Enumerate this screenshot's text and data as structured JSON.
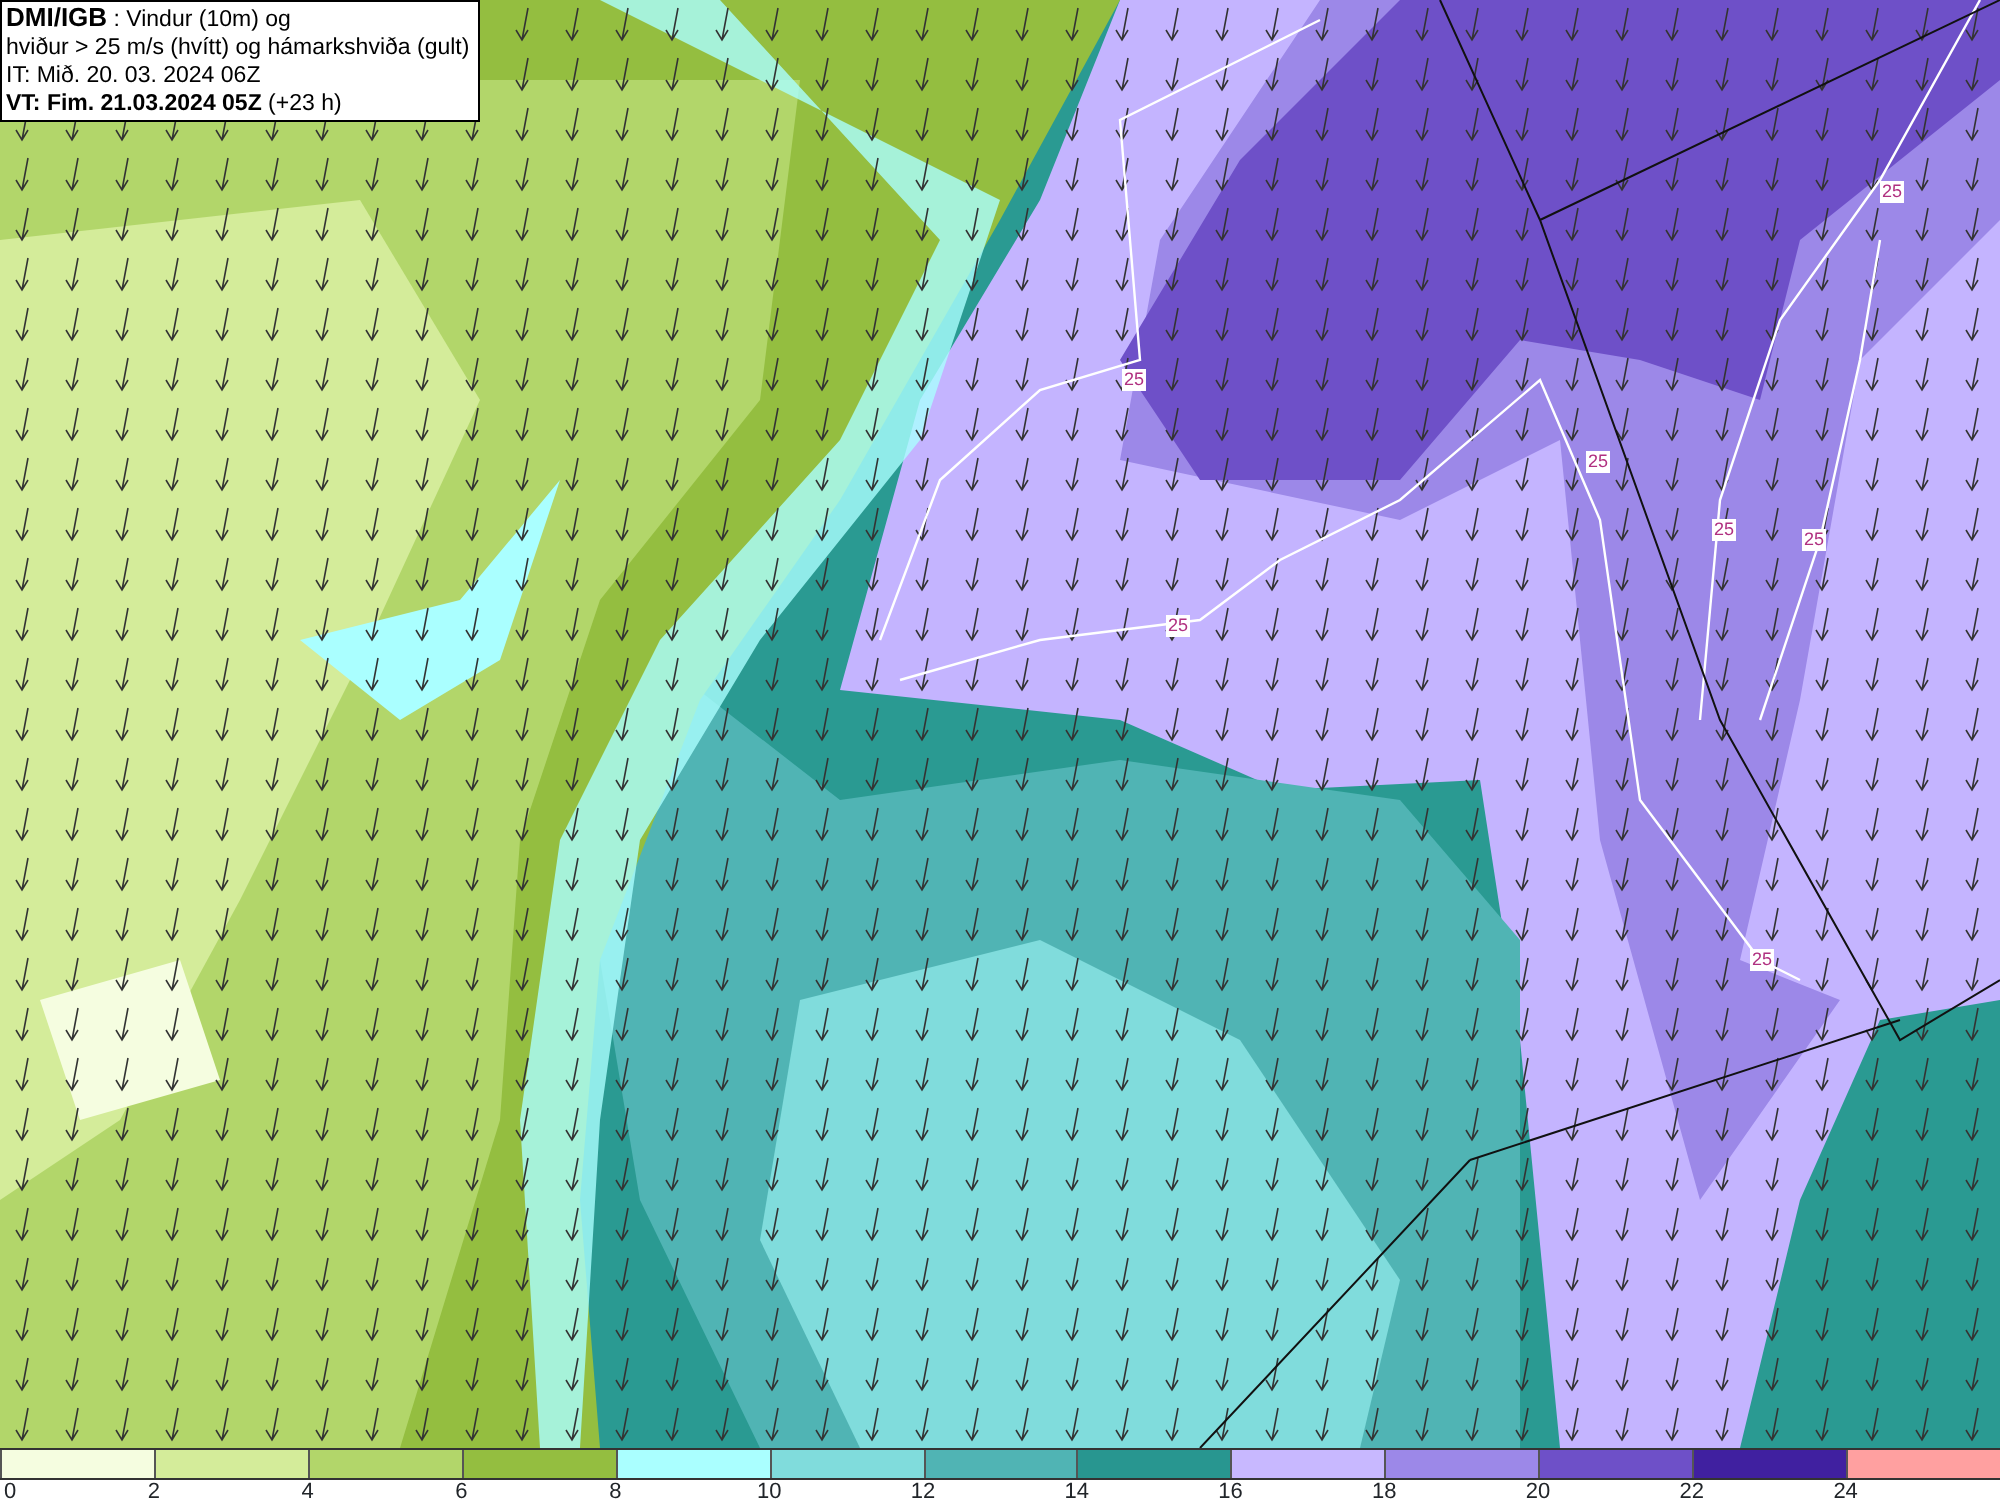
{
  "title_box": {
    "lines": [
      "**DMI/IGB** : Vindur (10m) og",
      "hviður > 25 m/s (hvítt) og hámarkshviða (gult)",
      "IT: Mið. 20. 03. 2024 06Z",
      "**VT: Fim. 21.03.2024 05Z** (+23 h)"
    ]
  },
  "map": {
    "kind": "map-picture",
    "contour_labels": [
      "25",
      "25",
      "25",
      "25",
      "25",
      "25",
      "25"
    ]
  },
  "legend": {
    "bins": [
      {
        "color": "#f5fde0"
      },
      {
        "color": "#d4ec9a"
      },
      {
        "color": "#b2d66a"
      },
      {
        "color": "#94be40"
      },
      {
        "color": "#aaffff"
      },
      {
        "color": "#80dcdc"
      },
      {
        "color": "#50b4b4"
      },
      {
        "color": "#289690"
      },
      {
        "color": "#c8b8ff"
      },
      {
        "color": "#9c88e8"
      },
      {
        "color": "#6e50c8"
      },
      {
        "color": "#4020a0"
      },
      {
        "color": "#ffa0a0"
      }
    ],
    "ticks": [
      "0",
      "2",
      "4",
      "6",
      "8",
      "10",
      "12",
      "14",
      "16",
      "18",
      "20",
      "22",
      "24"
    ]
  }
}
